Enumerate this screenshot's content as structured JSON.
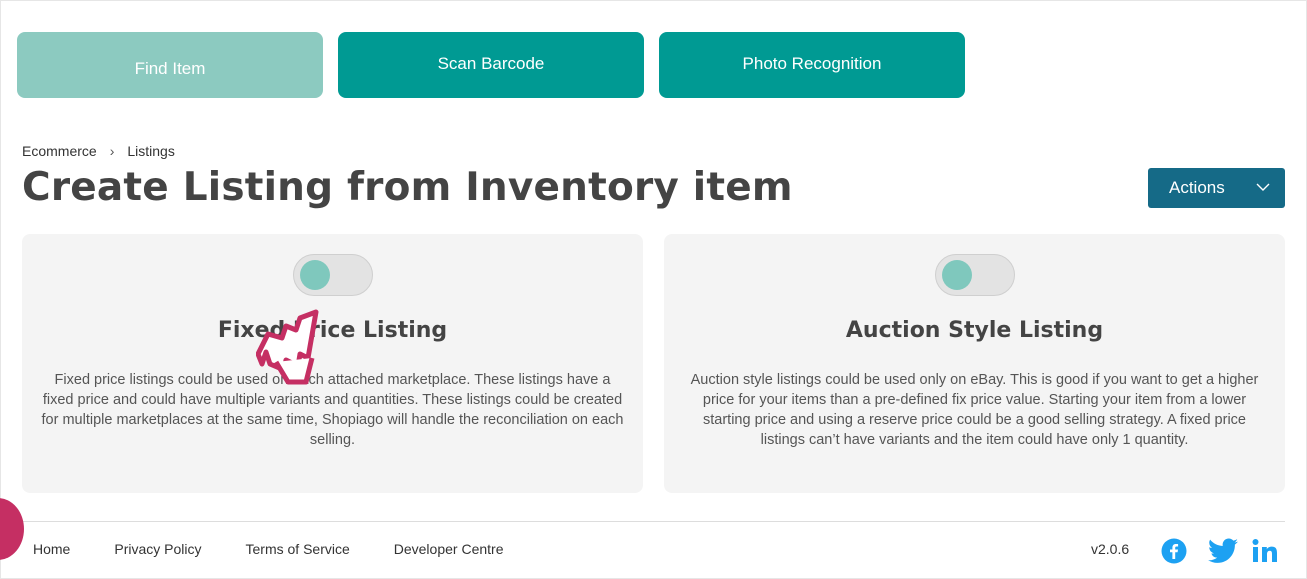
{
  "top_buttons": {
    "find_item": "Find Item",
    "scan_barcode": "Scan Barcode",
    "photo_recognition": "Photo Recognition"
  },
  "breadcrumb": {
    "parent": "Ecommerce",
    "current": "Listings"
  },
  "page_title": "Create Listing from Inventory item",
  "actions_label": "Actions",
  "cards": [
    {
      "title": "Fixed Price Listing",
      "description": "Fixed price listings could be used on each attached marketplace. These listings have a fixed price and could have multiple variants and quantities. These listings could be created for multiple marketplaces at the same time, Shopiago will handle the reconciliation on each selling."
    },
    {
      "title": "Auction Style Listing",
      "description": "Auction style listings could be used only on eBay. This is good if you want to get a higher price for your items than a pre-defined fix price value. Starting your item from a lower starting price and using a reserve price could be a good selling strategy. A fixed price listings can’t have variants and the item could have only 1 quantity."
    }
  ],
  "footer": {
    "links": [
      "Home",
      "Privacy Policy",
      "Terms of Service",
      "Developer Centre"
    ],
    "version": "v2.0.6"
  },
  "colors": {
    "teal": "#009a93",
    "teal_light": "#8ccac0",
    "actions_blue": "#156a87",
    "social_blue": "#1da1f2",
    "cursor_pink": "#c52f63"
  },
  "icons": [
    "chevron-down-icon",
    "facebook-icon",
    "twitter-icon",
    "linkedin-icon",
    "hand-pointer-cursor-icon"
  ]
}
